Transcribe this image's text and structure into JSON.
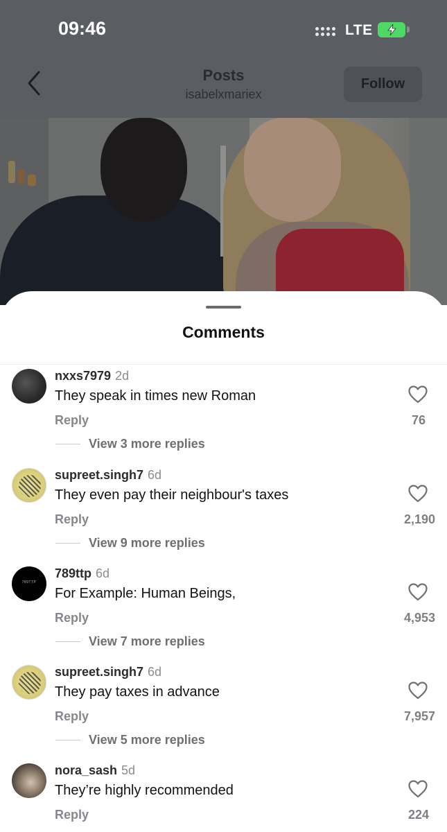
{
  "status_bar": {
    "time": "09:46",
    "network": "LTE"
  },
  "header": {
    "title": "Posts",
    "username": "isabelxmariex",
    "follow_label": "Follow"
  },
  "sheet": {
    "title": "Comments"
  },
  "comments": [
    {
      "username": "nxxs7979",
      "age": "2d",
      "text": "They speak in times new Roman",
      "reply_label": "Reply",
      "likes": "76",
      "more_replies": "View 3 more replies",
      "avatar": "dark-photo"
    },
    {
      "username": "supreet.singh7",
      "age": "6d",
      "text": "They even pay their neighbour's taxes",
      "reply_label": "Reply",
      "likes": "2,190",
      "more_replies": "View 9 more replies",
      "avatar": "yellow-pattern"
    },
    {
      "username": "789ttp",
      "age": "6d",
      "text": "For Example: Human Beings,",
      "reply_label": "Reply",
      "likes": "4,953",
      "more_replies": "View 7 more replies",
      "avatar": "black-logo",
      "avatar_text": "789TTP"
    },
    {
      "username": "supreet.singh7",
      "age": "6d",
      "text": "They pay taxes in advance",
      "reply_label": "Reply",
      "likes": "7,957",
      "more_replies": "View 5 more replies",
      "avatar": "yellow-pattern"
    },
    {
      "username": "nora_sash",
      "age": "5d",
      "text": "They’re highly recommended",
      "reply_label": "Reply",
      "likes": "224",
      "avatar": "photo"
    }
  ],
  "icons": {
    "back": "chevron-left-icon",
    "like": "heart-outline-icon",
    "battery": "battery-charging-icon",
    "signal": "signal-dots-icon"
  },
  "colors": {
    "battery": "#4dd964",
    "overlay": "#5a5d62"
  }
}
